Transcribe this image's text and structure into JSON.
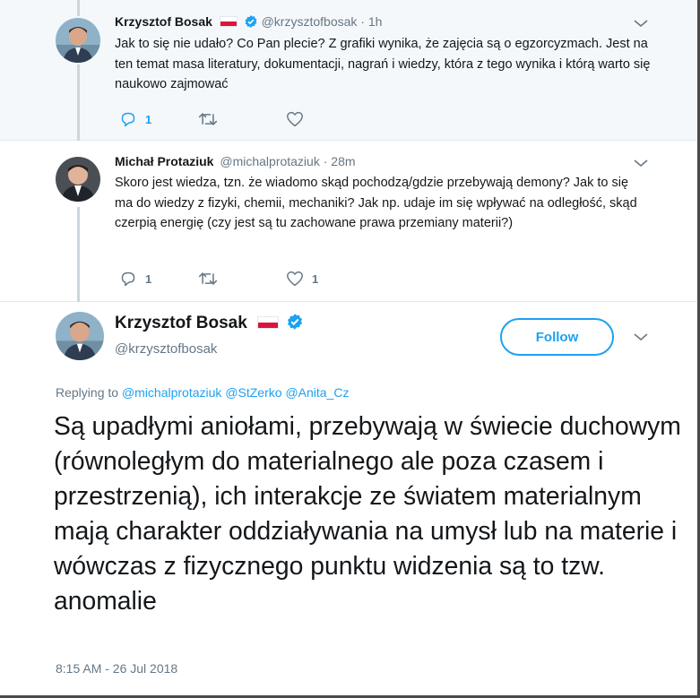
{
  "tweets": [
    {
      "name": "Krzysztof Bosak",
      "handle": "@krzysztofbosak",
      "time": "· 1h",
      "text": "Jak to się nie udało? Co Pan plecie? Z grafiki wynika, że zajęcia są o egzorcyzmach. Jest na ten temat masa literatury, dokumentacji, nagrań i wiedzy, która z tego wynika i którą warto się naukowo zajmować",
      "replies": "1",
      "retweets": "",
      "likes": ""
    },
    {
      "name": "Michał Protaziuk",
      "handle": "@michalprotaziuk",
      "time": "· 28m",
      "text": "Skoro jest wiedza, tzn. że wiadomo skąd pochodzą/gdzie przebywają demony? Jak to się ma do wiedzy z fizyki, chemii, mechaniki? Jak np. udaje im się wpływać na odległość, skąd czerpią energię (czy jest są tu zachowane prawa przemiany materii?)",
      "replies": "1",
      "retweets": "",
      "likes": "1"
    }
  ],
  "main_tweet": {
    "name": "Krzysztof Bosak",
    "handle": "@krzysztofbosak",
    "follow_label": "Follow",
    "replying_prefix": "Replying to",
    "replying_to": [
      "@michalprotaziuk",
      "@StZerko",
      "@Anita_Cz"
    ],
    "text": "Są upadłymi aniołami, przebywają w świecie duchowym (równoległym do materialnego ale poza czasem i przestrzenią), ich interakcje ze światem materialnym mają charakter oddziaływania na umysł lub na materie i wówczas z fizycznego punktu widzenia są to tzw. anomalie",
    "timestamp": "8:15 AM - 26 Jul 2018"
  },
  "colors": {
    "accent": "#1da1f2",
    "secondary_text": "#657786",
    "thread_line": "#ccd6dd",
    "flag_red": "#dc143c"
  },
  "icons": [
    "reply-icon",
    "retweet-icon",
    "like-icon",
    "verified-icon",
    "chevron-down-icon",
    "poland-flag-icon"
  ]
}
